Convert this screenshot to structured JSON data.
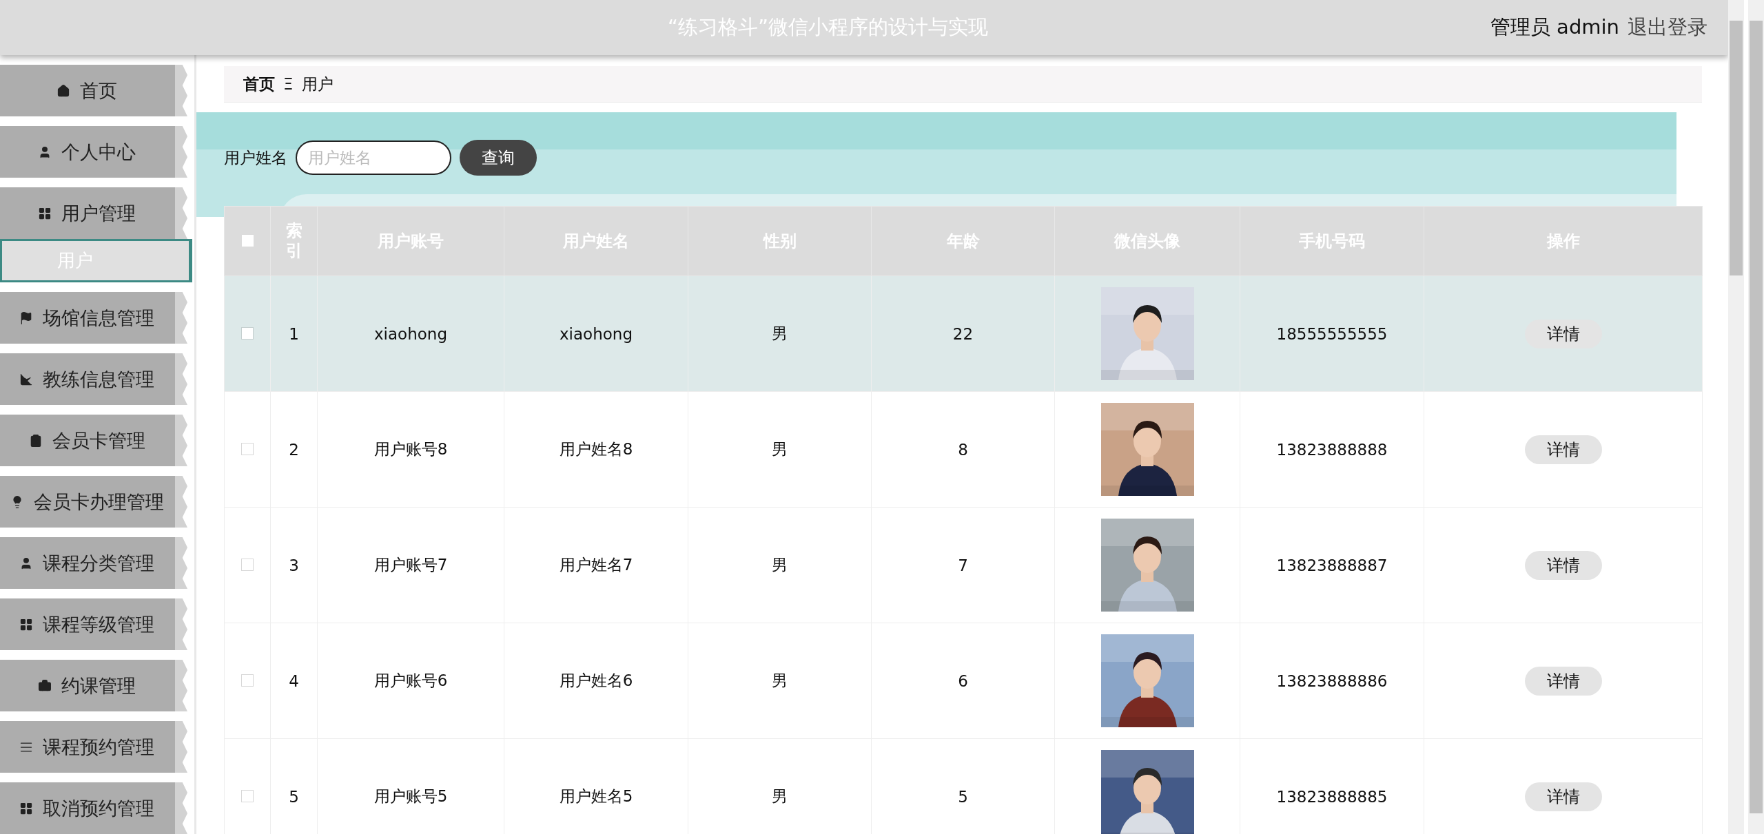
{
  "header": {
    "title": "“练习格斗”微信小程序的设计与实现",
    "user": "管理员 admin",
    "logout": "退出登录"
  },
  "sidebar": {
    "items": [
      {
        "label": "首页"
      },
      {
        "label": "个人中心"
      },
      {
        "label": "用户管理",
        "children": [
          {
            "label": "用户",
            "selected": true
          }
        ]
      },
      {
        "label": "场馆信息管理"
      },
      {
        "label": "教练信息管理"
      },
      {
        "label": "会员卡管理"
      },
      {
        "label": "会员卡办理管理"
      },
      {
        "label": "课程分类管理"
      },
      {
        "label": "课程等级管理"
      },
      {
        "label": "约课管理"
      },
      {
        "label": "课程预约管理"
      },
      {
        "label": "取消预约管理"
      }
    ]
  },
  "breadcrumb": {
    "items": [
      "首页",
      "用户"
    ],
    "separator": "Ξ"
  },
  "search": {
    "label": "用户姓名",
    "placeholder": "用户姓名",
    "button": "查询"
  },
  "table": {
    "select_all": {
      "checked": false
    },
    "columns": [
      "索引",
      "用户账号",
      "用户姓名",
      "性别",
      "年龄",
      "微信头像",
      "手机号码",
      "操作"
    ],
    "rows": [
      {
        "selected": true,
        "checked": false,
        "index": "1",
        "account": "xiaohong",
        "name": "xiaohong",
        "gender": "男",
        "age": "22",
        "phone": "18555555555",
        "action": "详情"
      },
      {
        "selected": false,
        "checked": false,
        "index": "2",
        "account": "用户账号8",
        "name": "用户姓名8",
        "gender": "男",
        "age": "8",
        "phone": "13823888888",
        "action": "详情"
      },
      {
        "selected": false,
        "checked": false,
        "index": "3",
        "account": "用户账号7",
        "name": "用户姓名7",
        "gender": "男",
        "age": "7",
        "phone": "13823888887",
        "action": "详情"
      },
      {
        "selected": false,
        "checked": false,
        "index": "4",
        "account": "用户账号6",
        "name": "用户姓名6",
        "gender": "男",
        "age": "6",
        "phone": "13823888886",
        "action": "详情"
      },
      {
        "selected": false,
        "checked": false,
        "index": "5",
        "account": "用户账号5",
        "name": "用户姓名5",
        "gender": "男",
        "age": "5",
        "phone": "13823888885",
        "action": "详情"
      }
    ]
  }
}
